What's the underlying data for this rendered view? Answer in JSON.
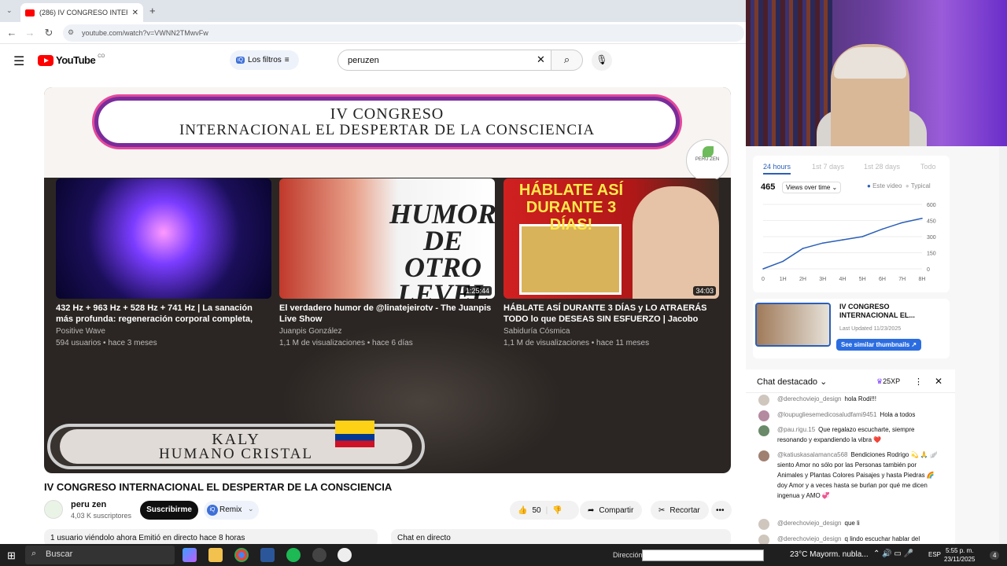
{
  "browser": {
    "tab_title": "(286) IV CONGRESO INTERNAC",
    "url": "youtube.com/watch?v=VWNN2TMwvFw"
  },
  "youtube": {
    "logo_text": "YouTube",
    "country_code": "CO",
    "filters_label": "Los filtros",
    "search_value": "peruzen"
  },
  "player": {
    "banner_line1": "IV CONGRESO",
    "banner_line2": "INTERNACIONAL EL DESPERTAR DE LA CONSCIENCIA",
    "speaker_line1": "KALY",
    "speaker_line2": "HUMANO CRISTAL",
    "logo_text": "PERU ZEN",
    "end_cards": [
      {
        "title": "432 Hz + 963 Hz + 528 Hz + 741 Hz | La sanación más profunda: regeneración corporal completa, ali...",
        "channel": "Positive Wave",
        "meta": "594 usuarios • hace 3 meses",
        "duration": ""
      },
      {
        "title": "El verdadero humor de @linatejeirotv - The Juanpis Live Show",
        "channel": "Juanpis González",
        "meta": "1,1 M de visualizaciones • hace 6 días",
        "duration": "1:25:44",
        "thumb_text": "HUMOR DE OTRO LEVEL"
      },
      {
        "title": "HÁBLATE ASÍ DURANTE 3 DÍAS y LO ATRAERÁS TODO lo que DESEAS SIN ESFUERZO | Jacobo Grinberg",
        "channel": "Sabiduría Cósmica",
        "meta": "1,1 M de visualizaciones • hace 11 meses",
        "duration": "34:03",
        "thumb_text": "HÁBLATE ASÍ DURANTE 3 DÍAS!"
      }
    ]
  },
  "video": {
    "title": "IV CONGRESO INTERNACIONAL EL DESPERTAR DE LA CONSCIENCIA",
    "channel": "peru zen",
    "subscribers": "4,03 K suscriptores",
    "subscribe_label": "Suscribirme",
    "remix_label": "Remix",
    "likes": "50",
    "share_label": "Compartir",
    "clip_label": "Recortar",
    "desc_line": "1 usuario viéndolo ahora  Emitió en directo hace 8 horas",
    "live_chat_label": "Chat en directo"
  },
  "analytics": {
    "tabs": [
      "24 hours",
      "1st 7 days",
      "1st 28 days",
      "Todo"
    ],
    "views_total": "465",
    "views_select": "Views over time",
    "legend_this": "Este video",
    "legend_typical": "Typical",
    "accent": "#2b5fb8"
  },
  "chart_data": {
    "type": "line",
    "x": [
      "0",
      "1H",
      "2H",
      "3H",
      "4H",
      "5H",
      "6H",
      "7H",
      "8H"
    ],
    "series": [
      {
        "name": "Este video",
        "values": [
          0,
          70,
          190,
          240,
          270,
          300,
          370,
          430,
          470
        ]
      }
    ],
    "yticks": [
      0,
      150,
      300,
      450,
      600
    ],
    "ylim": [
      0,
      600
    ],
    "grid": true
  },
  "thumb_card": {
    "title": "IV CONGRESO INTERNACIONAL EL...",
    "date": "Last Updated 11/23/2025",
    "button": "See similar thumbnails"
  },
  "chat": {
    "title": "Chat destacado",
    "xp": "25XP",
    "messages": [
      {
        "author": "@derechoviejo_design",
        "text": "hola Rodi!!!"
      },
      {
        "author": "@loupugliesemedicosaludfami9451",
        "text": "Hola a todos"
      },
      {
        "author": "@pau.rigu.15",
        "text": "Que regalazo escucharte, siempre resonando y expandiendo la vibra ❤️"
      },
      {
        "author": "@katiuskasalamanca568",
        "text": "Bendiciones Rodrigo 💫 🙏 🪽 siento Amor no sólo por las Personas también por Animales y Plantas Colores Paisajes y hasta Piedras 🌈 doy Amor y a veces hasta se burlan por qué me dicen ingenua y AMO 💞"
      },
      {
        "author": "@derechoviejo_design",
        "text": "que li"
      },
      {
        "author": "@derechoviejo_design",
        "text": "q lindo escuchar hablar del"
      }
    ]
  },
  "taskbar": {
    "search_label": "Buscar",
    "direccion_label": "Dirección",
    "weather": "23°C  Mayorm. nubla...",
    "lang": "ESP",
    "time": "5:55 p. m.",
    "date": "23/11/2025",
    "notif": "4"
  }
}
